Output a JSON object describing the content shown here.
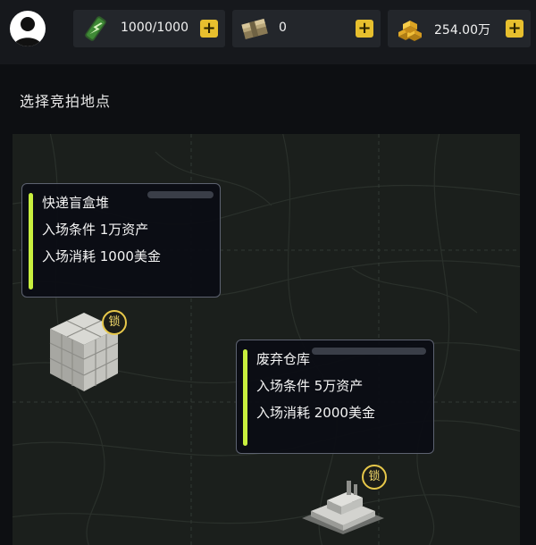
{
  "header": {
    "resources": [
      {
        "name": "energy",
        "icon": "energy-drink-icon",
        "value": "1000/1000"
      },
      {
        "name": "cash",
        "icon": "cash-stack-icon",
        "value": "0"
      },
      {
        "name": "gold",
        "icon": "gold-bars-icon",
        "value": "254.00万"
      }
    ],
    "plus_label": "+"
  },
  "page_title": "选择竞拍地点",
  "locations": [
    {
      "name": "快递盲盒堆",
      "entry_condition": "入场条件 1万资产",
      "entry_cost": "入场消耗 1000美金",
      "lock_label": "锁"
    },
    {
      "name": "废弃仓库",
      "entry_condition": "入场条件 5万资产",
      "entry_cost": "入场消耗 2000美金",
      "lock_label": "锁"
    }
  ],
  "colors": {
    "accent": "#c8ef3e",
    "gold": "#e7bf2e"
  }
}
